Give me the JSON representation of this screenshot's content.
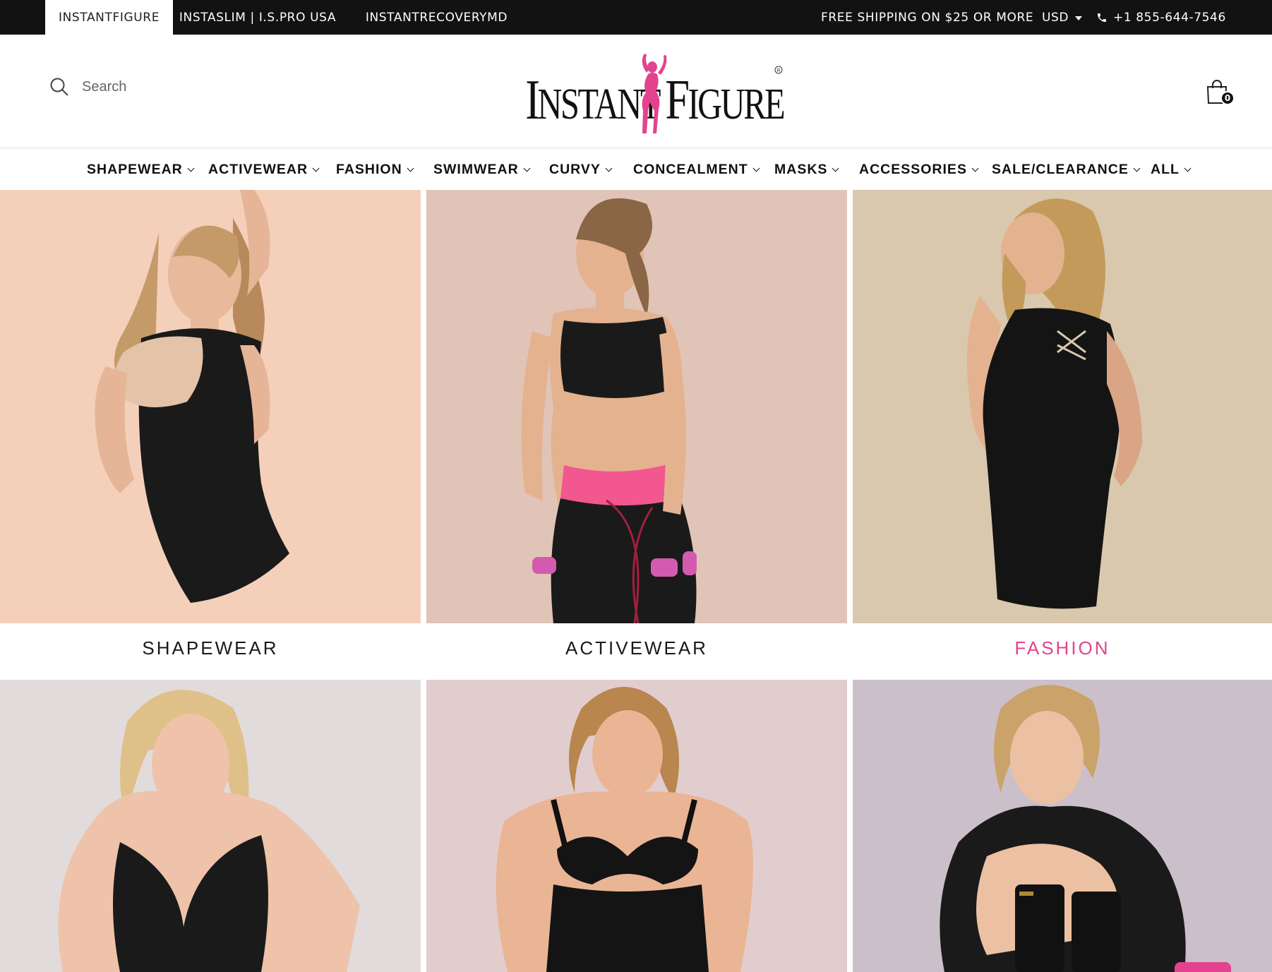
{
  "topbar": {
    "stores": [
      "INSTANTFIGURE",
      "INSTASLIM | I.S.PRO USA",
      "INSTANTRECOVERYMD"
    ],
    "shipping": "FREE SHIPPING ON $25 OR MORE",
    "currency": "USD",
    "phone": "+1 855-644-7546"
  },
  "header": {
    "search_placeholder": "Search",
    "logo_text": "INSTANT FIGURE",
    "cart_count": "0"
  },
  "nav": {
    "items": [
      "SHAPEWEAR",
      "ACTIVEWEAR",
      "FASHION",
      "SWIMWEAR",
      "CURVY",
      "CONCEALMENT",
      "MASKS",
      "ACCESSORIES",
      "SALE/CLEARANCE",
      "ALL"
    ]
  },
  "categories": {
    "tiles": [
      {
        "label": "SHAPEWEAR",
        "bg": "#f4d0bb"
      },
      {
        "label": "ACTIVEWEAR",
        "bg": "#e1c4b8"
      },
      {
        "label": "FASHION",
        "bg": "#d9c8ad"
      },
      {
        "label": "",
        "bg": "#e2dbdb"
      },
      {
        "label": "",
        "bg": "#e2cdce"
      },
      {
        "label": "",
        "bg": "#cbc0c9"
      }
    ]
  },
  "colors": {
    "topbar": "#121212",
    "accent_pink": "#e3438e"
  }
}
